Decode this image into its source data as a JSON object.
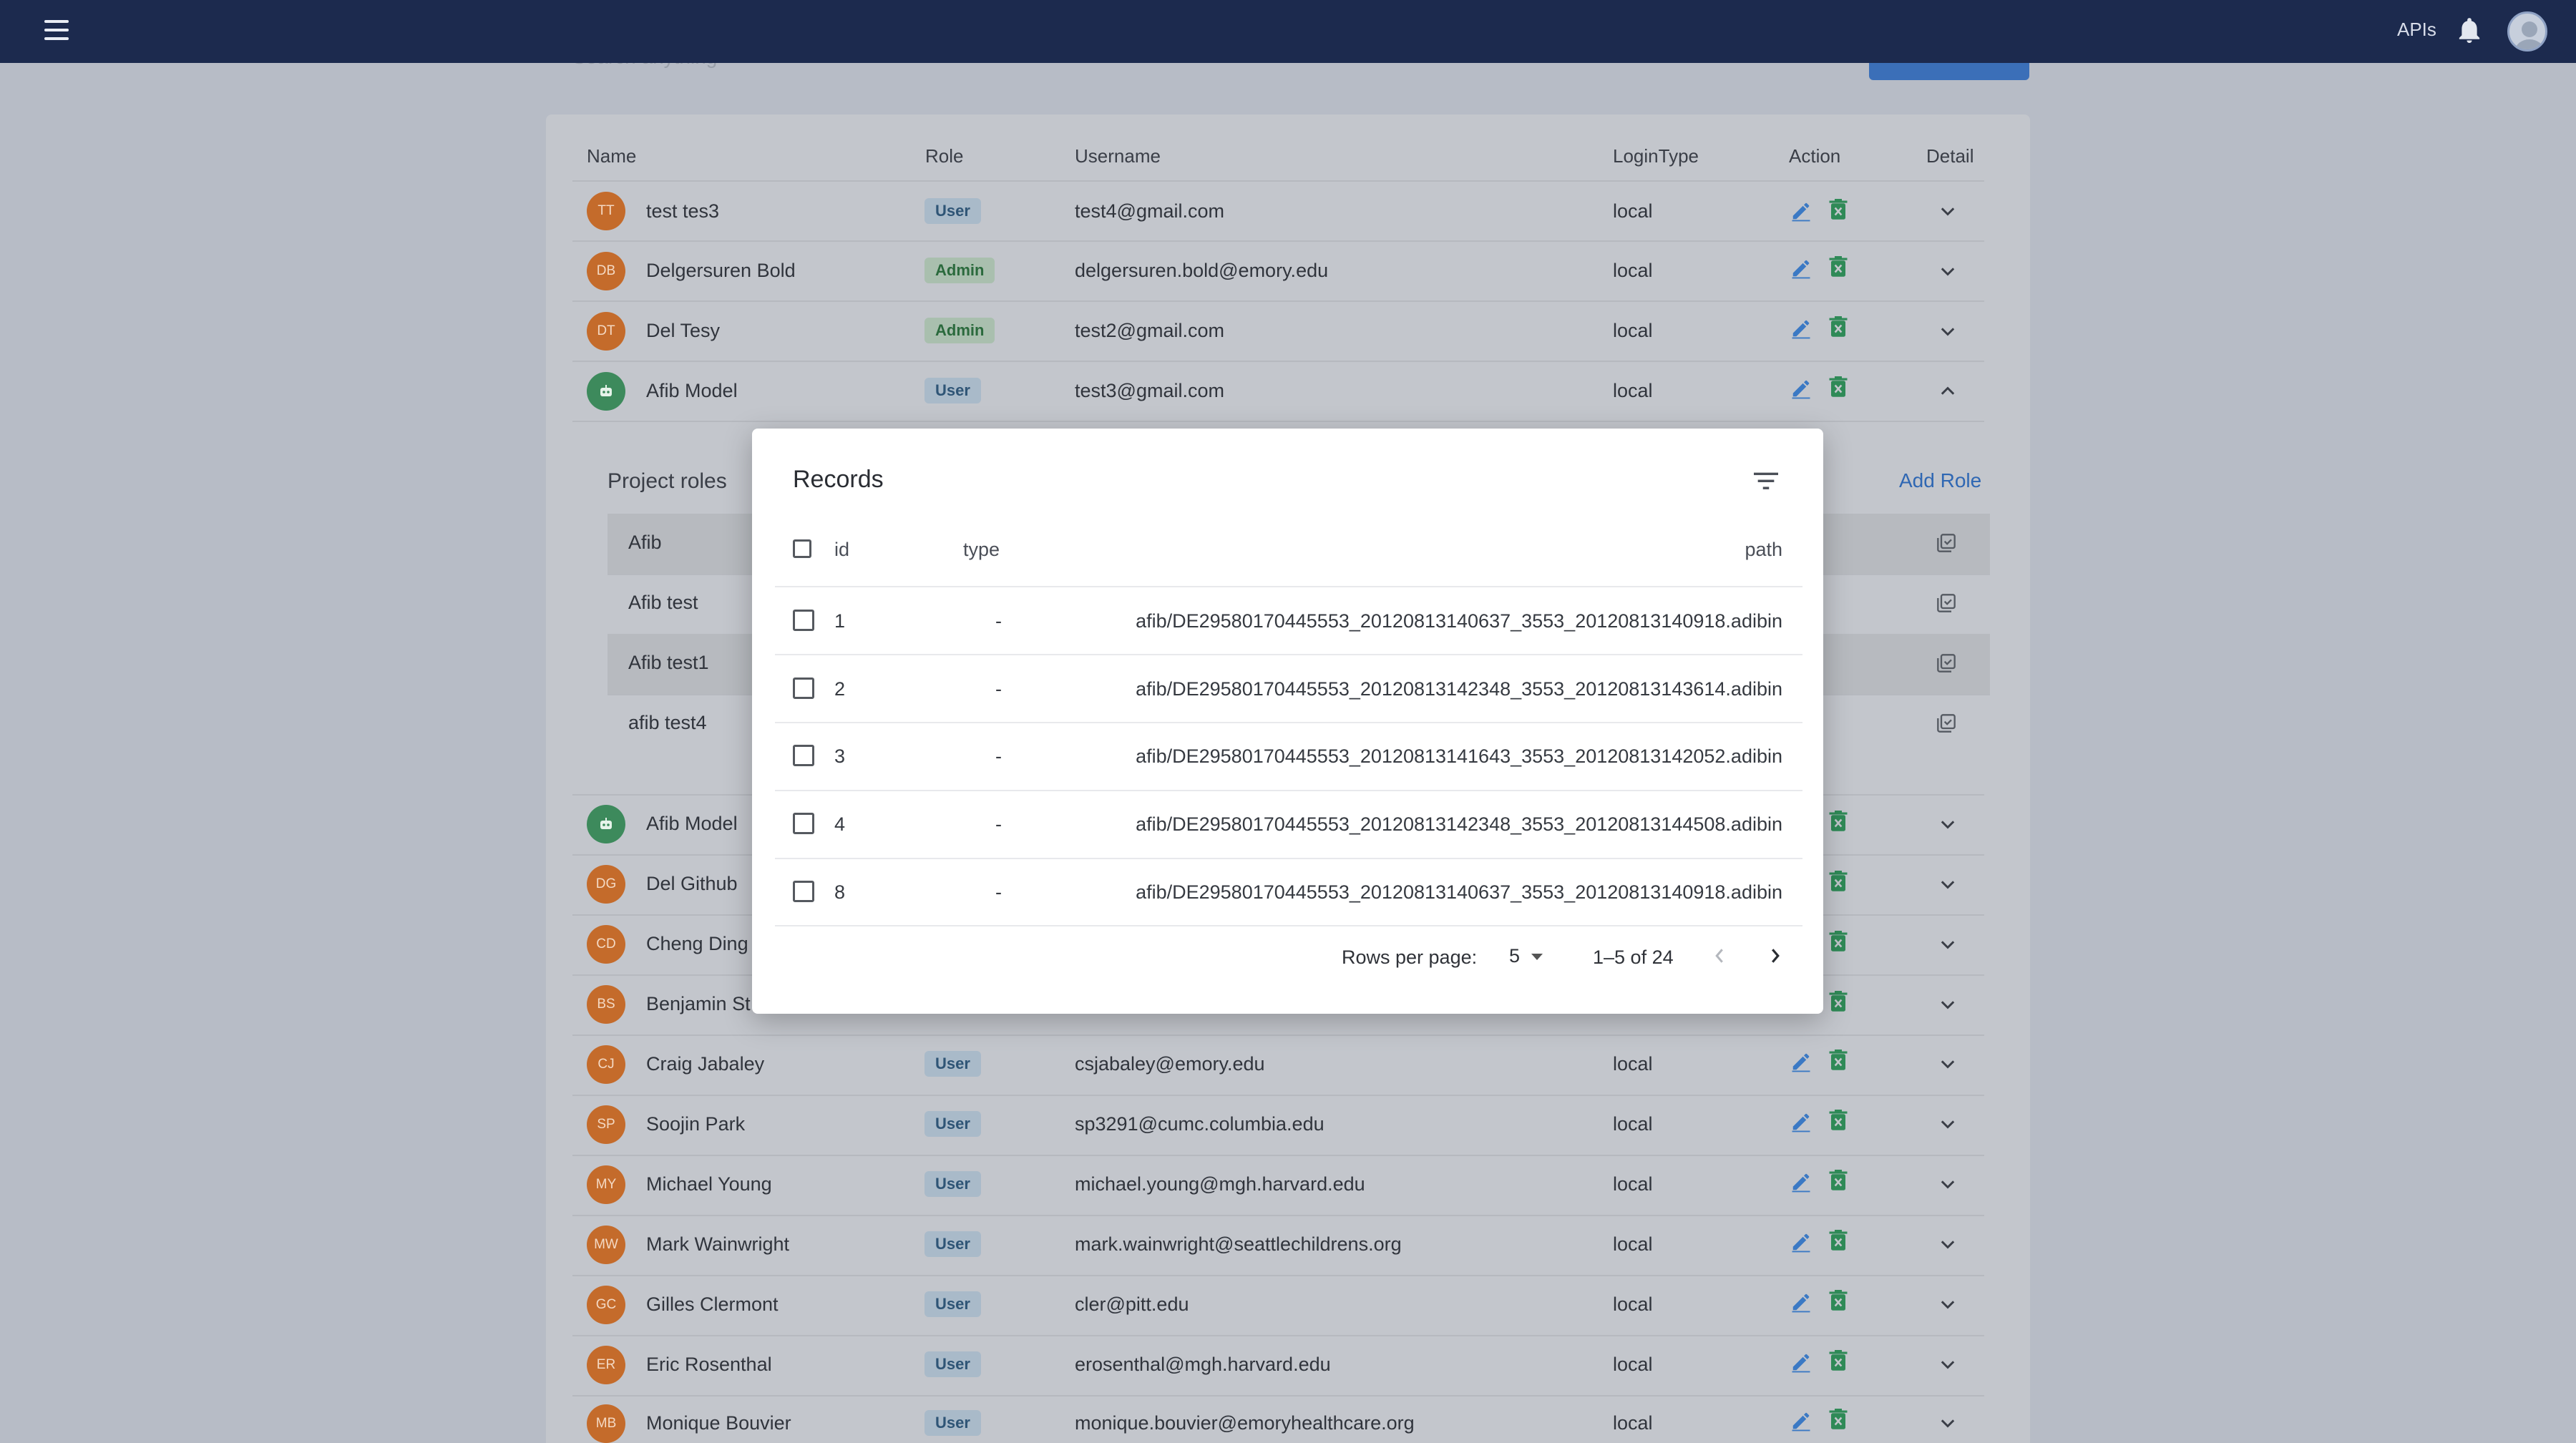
{
  "topbar": {
    "apis_label": "APIs"
  },
  "behind": {
    "search_placeholder": "Search anything"
  },
  "table": {
    "headers": {
      "name": "Name",
      "role": "Role",
      "username": "Username",
      "login_type": "LoginType",
      "action": "Action",
      "detail": "Detail"
    },
    "rows": [
      {
        "initials": "TT",
        "name": "test tes3",
        "role": "User",
        "username": "test4@gmail.com",
        "login": "local"
      },
      {
        "initials": "DB",
        "name": "Delgersuren Bold",
        "role": "Admin",
        "username": "delgersuren.bold@emory.edu",
        "login": "local"
      },
      {
        "initials": "DT",
        "name": "Del Tesy",
        "role": "Admin",
        "username": "test2@gmail.com",
        "login": "local"
      },
      {
        "initials": "",
        "name": "Afib Model",
        "role": "User",
        "username": "test3@gmail.com",
        "login": "local"
      },
      {
        "initials": "",
        "name": "Afib Model"
      },
      {
        "initials": "DG",
        "name": "Del Github"
      },
      {
        "initials": "CD",
        "name": "Cheng Ding"
      },
      {
        "initials": "BS",
        "name": "Benjamin St"
      },
      {
        "initials": "CJ",
        "name": "Craig Jabaley",
        "role": "User",
        "username": "csjabaley@emory.edu",
        "login": "local"
      },
      {
        "initials": "SP",
        "name": "Soojin Park",
        "role": "User",
        "username": "sp3291@cumc.columbia.edu",
        "login": "local"
      },
      {
        "initials": "MY",
        "name": "Michael Young",
        "role": "User",
        "username": "michael.young@mgh.harvard.edu",
        "login": "local"
      },
      {
        "initials": "MW",
        "name": "Mark Wainwright",
        "role": "User",
        "username": "mark.wainwright@seattlechildrens.org",
        "login": "local"
      },
      {
        "initials": "GC",
        "name": "Gilles Clermont",
        "role": "User",
        "username": "cler@pitt.edu",
        "login": "local"
      },
      {
        "initials": "ER",
        "name": "Eric Rosenthal",
        "role": "User",
        "username": "erosenthal@mgh.harvard.edu",
        "login": "local"
      },
      {
        "initials": "MB",
        "name": "Monique Bouvier",
        "role": "User",
        "username": "monique.bouvier@emoryhealthcare.org",
        "login": "local"
      }
    ]
  },
  "project_roles": {
    "title": "Project roles",
    "add_label": "Add Role",
    "items": [
      "Afib",
      "Afib test",
      "Afib test1",
      "afib test4"
    ]
  },
  "modal": {
    "title": "Records",
    "columns": {
      "id": "id",
      "type": "type",
      "path": "path"
    },
    "rows": [
      {
        "id": "1",
        "type": "-",
        "path": "afib/DE29580170445553_20120813140637_3553_20120813140918.adibin"
      },
      {
        "id": "2",
        "type": "-",
        "path": "afib/DE29580170445553_20120813142348_3553_20120813143614.adibin"
      },
      {
        "id": "3",
        "type": "-",
        "path": "afib/DE29580170445553_20120813141643_3553_20120813142052.adibin"
      },
      {
        "id": "4",
        "type": "-",
        "path": "afib/DE29580170445553_20120813142348_3553_20120813144508.adibin"
      },
      {
        "id": "8",
        "type": "-",
        "path": "afib/DE29580170445553_20120813140637_3553_20120813140918.adibin"
      }
    ],
    "pager": {
      "rows_per_page_label": "Rows per page:",
      "rows_per_page": "5",
      "range": "1–5 of 24"
    }
  },
  "colors": {
    "topbar": "#1c2a4e",
    "accent": "#2f67b3",
    "avatar": "#c46b2b",
    "bot_avatar": "#3d8a5c",
    "action_edit": "#3b79c4",
    "action_delete": "#2f8a57"
  }
}
